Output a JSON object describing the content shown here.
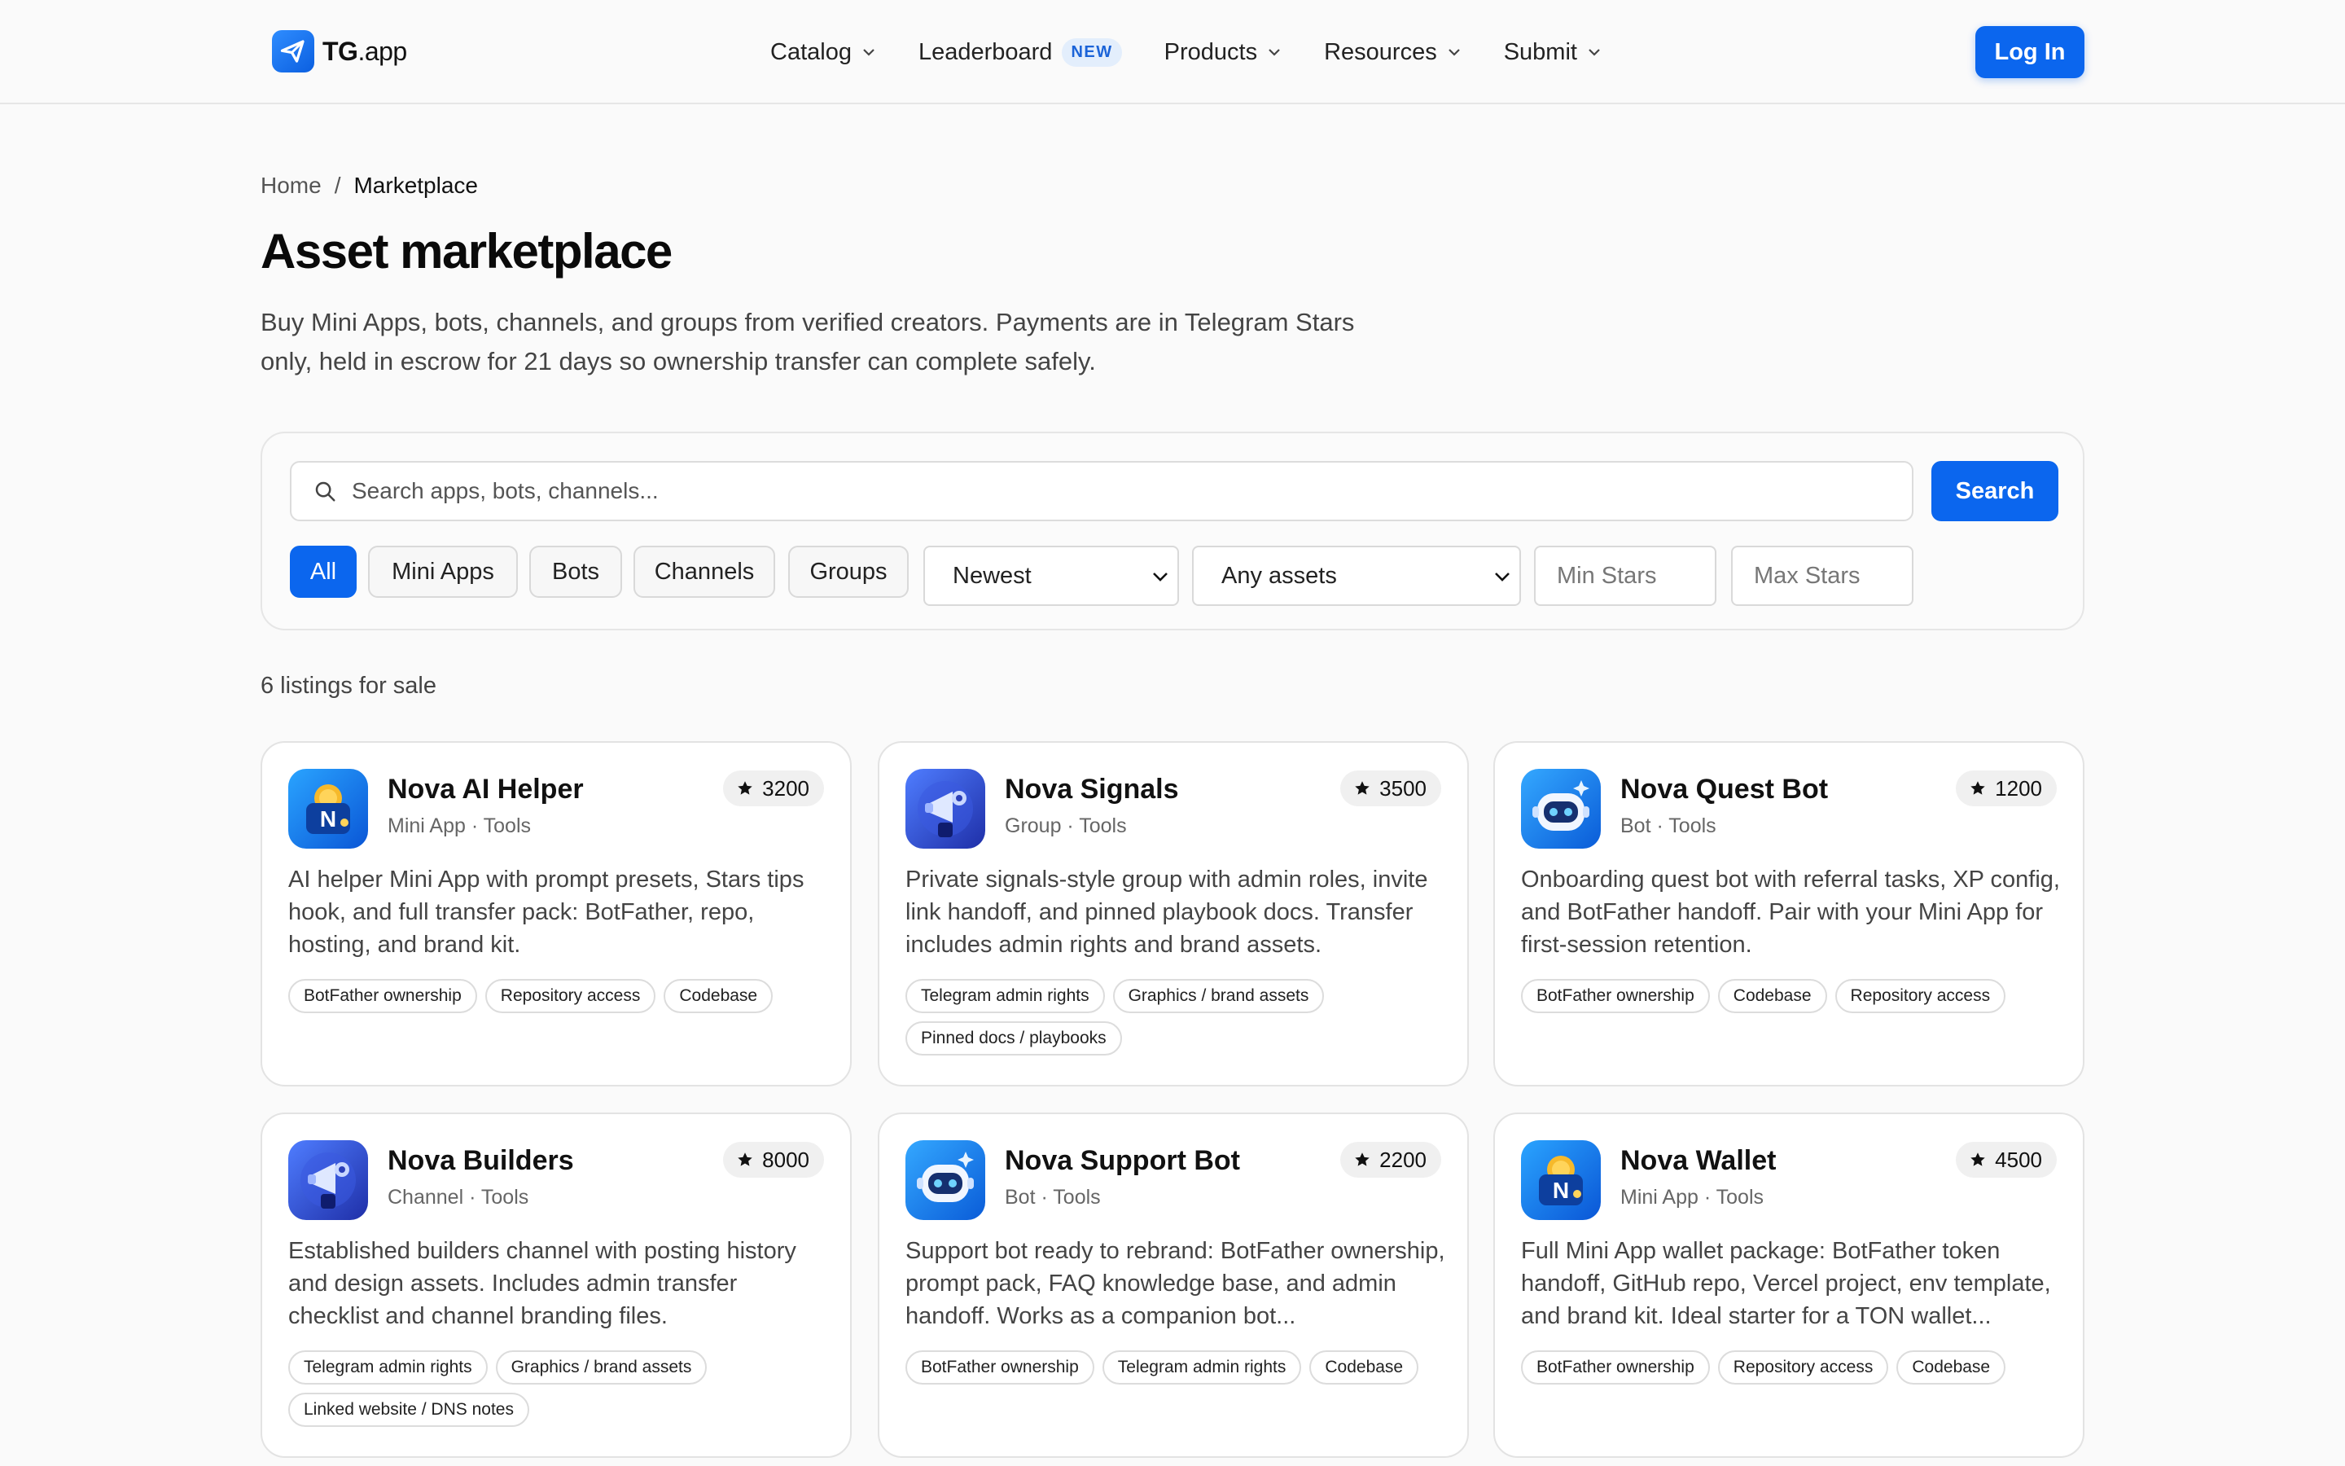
{
  "brand": {
    "name_bold": "TG",
    "name_rest": ".app"
  },
  "nav": {
    "items": [
      {
        "label": "Catalog",
        "dropdown": true
      },
      {
        "label": "Leaderboard",
        "badge": "NEW"
      },
      {
        "label": "Products",
        "dropdown": true
      },
      {
        "label": "Resources",
        "dropdown": true
      },
      {
        "label": "Submit",
        "dropdown": true
      }
    ],
    "login_label": "Log In"
  },
  "breadcrumb": {
    "home": "Home",
    "separator": "/",
    "current": "Marketplace"
  },
  "page": {
    "title": "Asset marketplace",
    "description": "Buy Mini Apps, bots, channels, and groups from verified creators. Payments are in Telegram Stars only, held in escrow for 21 days so ownership transfer can complete safely."
  },
  "filters": {
    "search_placeholder": "Search apps, bots, channels...",
    "search_button": "Search",
    "chips": [
      {
        "label": "All",
        "active": true
      },
      {
        "label": "Mini Apps",
        "active": false
      },
      {
        "label": "Bots",
        "active": false
      },
      {
        "label": "Channels",
        "active": false
      },
      {
        "label": "Groups",
        "active": false
      }
    ],
    "sort_selected": "Newest",
    "assets_selected": "Any assets",
    "min_placeholder": "Min Stars",
    "max_placeholder": "Max Stars"
  },
  "listing_count": "6 listings for sale",
  "colors": {
    "accent": "#0b66ee",
    "badge_bg": "#e3eefc",
    "badge_text": "#1c64d8"
  },
  "listings": [
    {
      "title": "Nova AI Helper",
      "meta": "Mini App · Tools",
      "price": "3200",
      "icon": "wallet-app-icon",
      "description": "AI helper Mini App with prompt presets, Stars tips hook, and full transfer pack: BotFather, repo, hosting, and brand kit.",
      "tags": [
        "BotFather ownership",
        "Repository access",
        "Codebase"
      ]
    },
    {
      "title": "Nova Signals",
      "meta": "Group · Tools",
      "price": "3500",
      "icon": "megaphone-robot-icon",
      "description": "Private signals-style group with admin roles, invite link handoff, and pinned playbook docs. Transfer includes admin rights and brand assets.",
      "tags": [
        "Telegram admin rights",
        "Graphics / brand assets",
        "Pinned docs / playbooks"
      ]
    },
    {
      "title": "Nova Quest Bot",
      "meta": "Bot · Tools",
      "price": "1200",
      "icon": "robot-head-icon",
      "description": "Onboarding quest bot with referral tasks, XP config, and BotFather handoff. Pair with your Mini App for first-session retention.",
      "tags": [
        "BotFather ownership",
        "Codebase",
        "Repository access"
      ]
    },
    {
      "title": "Nova Builders",
      "meta": "Channel · Tools",
      "price": "8000",
      "icon": "megaphone-robot-icon",
      "description": "Established builders channel with posting history and design assets. Includes admin transfer checklist and channel branding files.",
      "tags": [
        "Telegram admin rights",
        "Graphics / brand assets",
        "Linked website / DNS notes"
      ]
    },
    {
      "title": "Nova Support Bot",
      "meta": "Bot · Tools",
      "price": "2200",
      "icon": "robot-head-icon",
      "description": "Support bot ready to rebrand: BotFather ownership, prompt pack, FAQ knowledge base, and admin handoff. Works as a companion bot...",
      "tags": [
        "BotFather ownership",
        "Telegram admin rights",
        "Codebase"
      ]
    },
    {
      "title": "Nova Wallet",
      "meta": "Mini App · Tools",
      "price": "4500",
      "icon": "wallet-app-icon",
      "description": "Full Mini App wallet package: BotFather token handoff, GitHub repo, Vercel project, env template, and brand kit. Ideal starter for a TON wallet...",
      "tags": [
        "BotFather ownership",
        "Repository access",
        "Codebase"
      ]
    }
  ]
}
